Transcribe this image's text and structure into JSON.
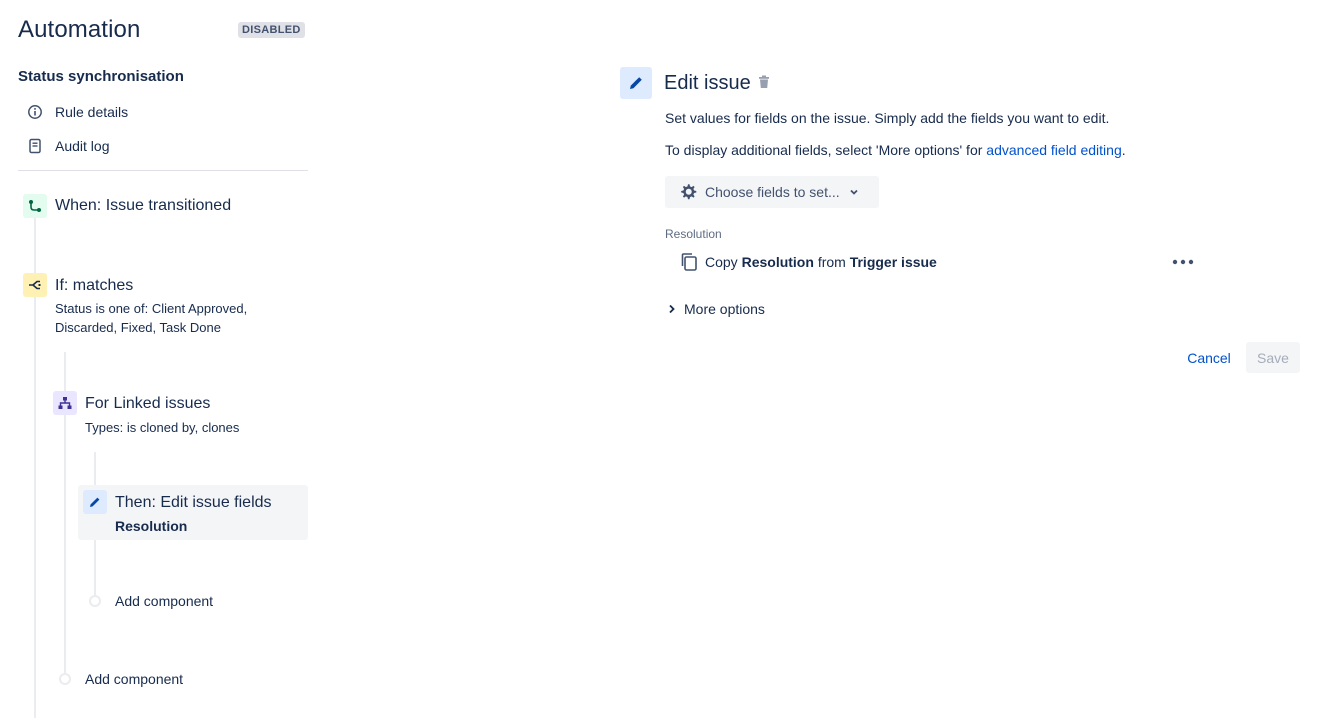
{
  "header": {
    "title": "Automation",
    "status_badge": "DISABLED"
  },
  "rule": {
    "name": "Status synchronisation",
    "nav": [
      {
        "label": "Rule details",
        "icon": "info-icon"
      },
      {
        "label": "Audit log",
        "icon": "document-icon"
      }
    ]
  },
  "components": {
    "trigger": {
      "title": "When: Issue transitioned",
      "icon": "transition-icon",
      "color": "#e3fcef"
    },
    "condition": {
      "title": "If: matches",
      "subtitle_line1": "Status is one of: Client Approved,",
      "subtitle_line2": "Discarded, Fixed, Task Done",
      "icon": "condition-branch-icon",
      "color": "#fff0b3"
    },
    "branch": {
      "title": "For Linked issues",
      "subtitle": "Types: is cloned by, clones",
      "icon": "hierarchy-icon",
      "color": "#eae6ff"
    },
    "action": {
      "title": "Then: Edit issue fields",
      "subtitle": "Resolution",
      "icon": "pencil-icon",
      "color": "#deebff"
    },
    "add_inner": "Add component",
    "add_outer": "Add component"
  },
  "editor": {
    "title": "Edit issue",
    "description": "Set values for fields on the issue. Simply add the fields you want to edit.",
    "hint_prefix": "To display additional fields, select 'More options' for ",
    "hint_link": "advanced field editing",
    "hint_suffix": ".",
    "choose_fields_label": "Choose fields to set...",
    "field_label": "Resolution",
    "field_row": {
      "verb": "Copy",
      "field": "Resolution",
      "from": "from",
      "source": "Trigger issue"
    },
    "more_options_label": "More options",
    "cancel_label": "Cancel",
    "save_label": "Save"
  },
  "colors": {
    "link": "#0052cc",
    "text": "#172b4d"
  }
}
